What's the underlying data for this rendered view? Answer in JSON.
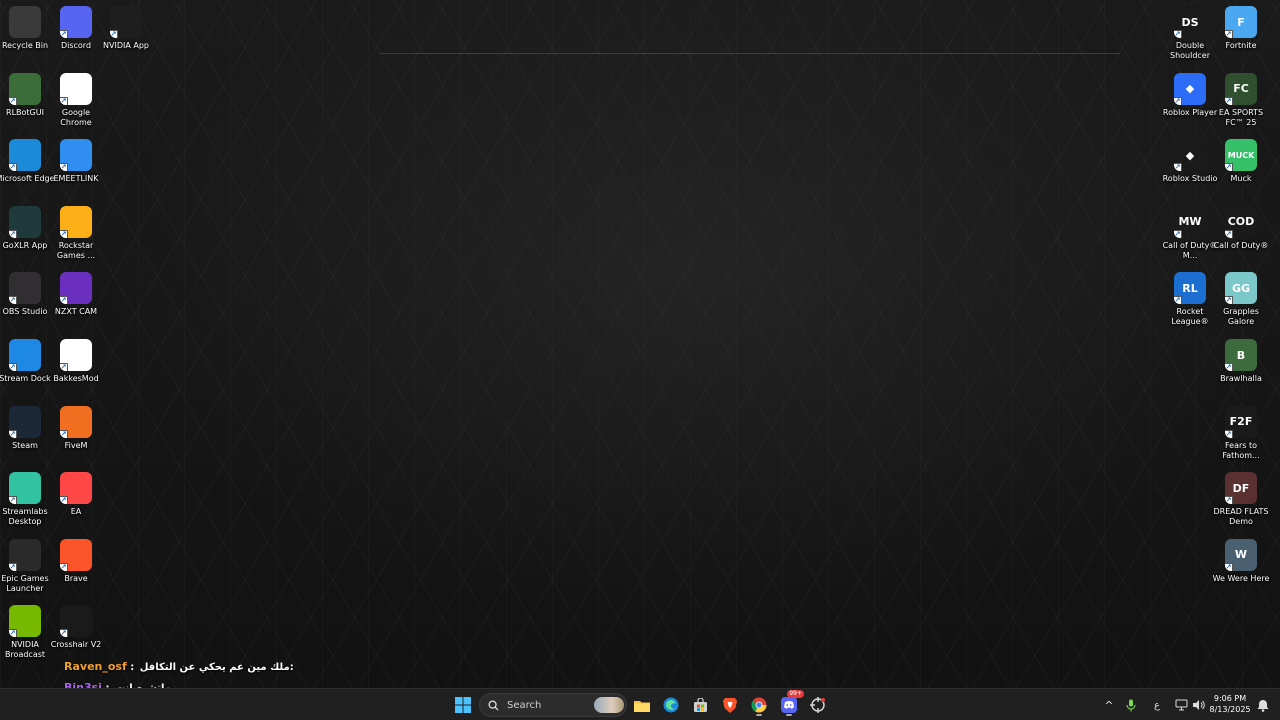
{
  "desktop": {
    "left_icons": [
      {
        "label": "Recycle Bin",
        "icon": "recycle-bin-icon",
        "color": "#3a3a3a"
      },
      {
        "label": "Discord",
        "icon": "discord-icon",
        "color": "#5865f2"
      },
      {
        "label": "NVIDIA App",
        "icon": "nvidia-icon",
        "color": "#1e1e1e"
      },
      {
        "label": "RLBotGUI",
        "icon": "rlbot-icon",
        "color": "#3b6d3b"
      },
      {
        "label": "Google Chrome",
        "icon": "chrome-icon",
        "color": "#ffffff"
      },
      {
        "label": "Microsoft Edge",
        "icon": "edge-icon",
        "color": "#1b8ad8"
      },
      {
        "label": "EMEETLINK",
        "icon": "emeetlink-icon",
        "color": "#2f8ef0"
      },
      {
        "label": "GoXLR App",
        "icon": "goxlr-icon",
        "color": "#1f3a3a"
      },
      {
        "label": "Rockstar Games ...",
        "icon": "rockstar-icon",
        "color": "#fcaf17"
      },
      {
        "label": "OBS Studio",
        "icon": "obs-icon",
        "color": "#302e31"
      },
      {
        "label": "NZXT CAM",
        "icon": "nzxt-icon",
        "color": "#6b2fbf"
      },
      {
        "label": "Stream Dock",
        "icon": "stream-dock-icon",
        "color": "#1e88e5"
      },
      {
        "label": "BakkesMod",
        "icon": "bakkesmod-icon",
        "color": "#ffffff"
      },
      {
        "label": "Steam",
        "icon": "steam-icon",
        "color": "#1b2838"
      },
      {
        "label": "FiveM",
        "icon": "fivem-icon",
        "color": "#f26f22"
      },
      {
        "label": "Streamlabs Desktop",
        "icon": "streamlabs-icon",
        "color": "#31c3a2"
      },
      {
        "label": "EA",
        "icon": "ea-icon",
        "color": "#ff4747"
      },
      {
        "label": "Epic Games Launcher",
        "icon": "epic-games-icon",
        "color": "#2a2a2a"
      },
      {
        "label": "Brave",
        "icon": "brave-icon",
        "color": "#fb542b"
      },
      {
        "label": "NVIDIA Broadcast",
        "icon": "nvidia-broadcast-icon",
        "color": "#76b900"
      },
      {
        "label": "Crosshair V2",
        "icon": "crosshair-icon",
        "color": "#1a1a1a"
      }
    ],
    "right_icons": [
      {
        "label": "Double Shouldcer",
        "icon": "double-shouldcer-icon",
        "color": "#1a1a1a",
        "glyph": "DS"
      },
      {
        "label": "Fortnite",
        "icon": "fortnite-icon",
        "color": "#4aa8f0",
        "glyph": "F"
      },
      {
        "label": "Roblox Player",
        "icon": "roblox-player-icon",
        "color": "#2c6cf6",
        "glyph": "◆"
      },
      {
        "label": "EA SPORTS FC™ 25",
        "icon": "ea-fc-icon",
        "color": "#2f4f2f",
        "glyph": "FC"
      },
      {
        "label": "Roblox Studio",
        "icon": "roblox-studio-icon",
        "color": "#1a1a1a",
        "glyph": "◆"
      },
      {
        "label": "Muck",
        "icon": "muck-icon",
        "color": "#36c06a",
        "glyph": "MUCK"
      },
      {
        "label": "Call of Duty® M...",
        "icon": "cod-mw3-icon",
        "color": "#1a1a1a",
        "glyph": "MW"
      },
      {
        "label": "Call of Duty®",
        "icon": "call-of-duty-icon",
        "color": "#1a1a1a",
        "glyph": "COD"
      },
      {
        "label": "Rocket League®",
        "icon": "rocket-league-icon",
        "color": "#1c6fd1",
        "glyph": "RL"
      },
      {
        "label": "Grapples Galore",
        "icon": "grapples-galore-icon",
        "color": "#7cc7c9",
        "glyph": "GG"
      },
      {
        "label": "Brawlhalla",
        "icon": "brawlhalla-icon",
        "color": "#3d6b3d",
        "glyph": "B"
      },
      {
        "label": "Fears to Fathom...",
        "icon": "fears-to-fathom-icon",
        "color": "#1a1a1a",
        "glyph": "F2F"
      },
      {
        "label": "DREAD FLATS Demo",
        "icon": "dread-flats-icon",
        "color": "#5a3030",
        "glyph": "DF"
      },
      {
        "label": "We Were Here",
        "icon": "we-were-here-icon",
        "color": "#4a6070",
        "glyph": "W"
      }
    ]
  },
  "chat": [
    {
      "user": "Raven_osf",
      "user_color": "#f0a030",
      "separator": " : ",
      "message": "ملك مين عم يحكي عن التكافل:"
    },
    {
      "user": "Bin3si",
      "user_color": "#b060f0",
      "separator": " : ",
      "message": "ماتشبع انت"
    }
  ],
  "taskbar": {
    "search_placeholder": "Search",
    "tray": {
      "chevron": "^",
      "language": "ع",
      "time": "9:06 PM",
      "date": "8/13/2025",
      "discord_badge": "99+"
    }
  }
}
